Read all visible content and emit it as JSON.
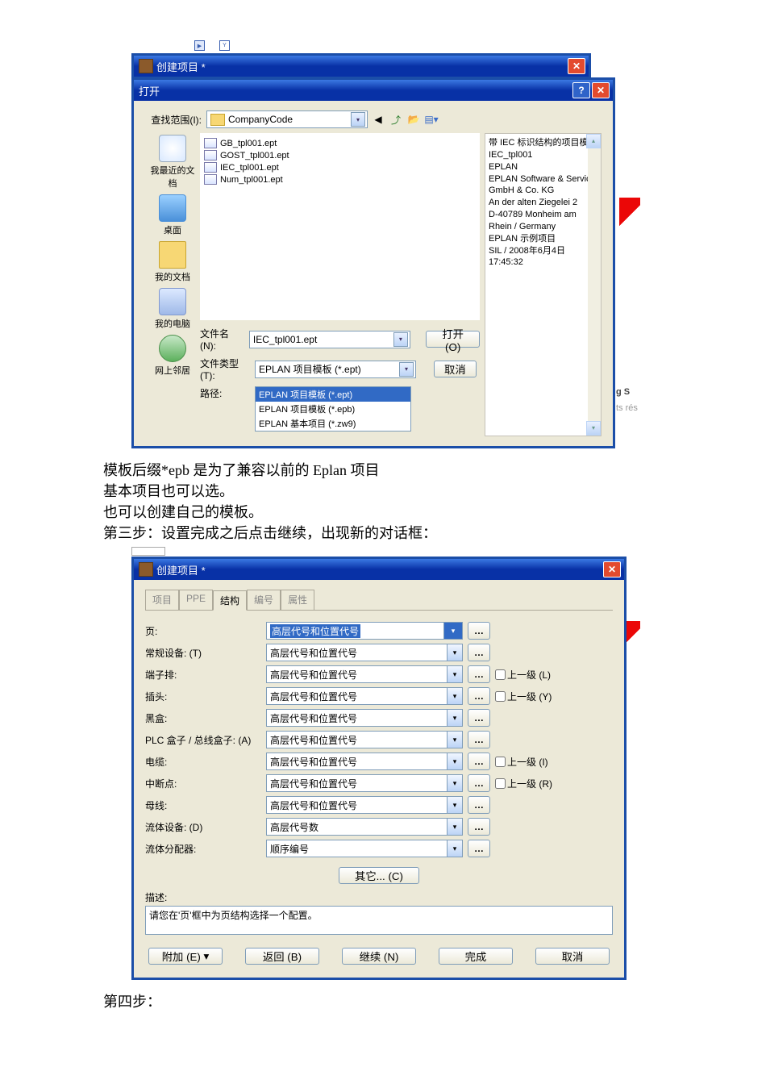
{
  "file_dialog": {
    "outer_title": "创建项目 *",
    "inner_title": "打开",
    "look_in_label": "查找范围(I):",
    "folder_name": "CompanyCode",
    "places": [
      {
        "label": "我最近的文档"
      },
      {
        "label": "桌面"
      },
      {
        "label": "我的文档"
      },
      {
        "label": "我的电脑"
      },
      {
        "label": "网上邻居"
      }
    ],
    "files": [
      {
        "name": "GB_tpl001.ept"
      },
      {
        "name": "GOST_tpl001.ept"
      },
      {
        "name": "IEC_tpl001.ept"
      },
      {
        "name": "Num_tpl001.ept"
      }
    ],
    "filename_label": "文件名(N):",
    "filename_value": "IEC_tpl001.ept",
    "filetype_label": "文件类型(T):",
    "filetype_value": "EPLAN 项目模板 (*.ept)",
    "filetype_options": [
      "EPLAN 项目模板 (*.ept)",
      "EPLAN 项目模板 (*.epb)",
      "EPLAN 基本项目 (*.zw9)"
    ],
    "path_label": "路径:",
    "open_btn": "打开(O)",
    "cancel_btn": "取消",
    "info_lines": [
      "带 IEC 标识结构的项目模板",
      "IEC_tpl001",
      "EPLAN",
      "EPLAN Software & Service",
      "GmbH & Co. KG",
      "An der alten Ziegelei 2",
      "D-40789 Monheim am Rhein / Germany",
      "EPLAN 示例项目",
      "SIL / 2008年6月4日 17:45:32"
    ]
  },
  "body_text": {
    "p1": "模板后缀*epb 是为了兼容以前的 Eplan 项目",
    "p2": "基本项目也可以选。",
    "p3": "也可以创建自己的模板。",
    "p4": "第三步：设置完成之后点击继续，出现新的对话框：",
    "p5": "第四步："
  },
  "wizard": {
    "title": "创建项目 *",
    "tabs": [
      "项目",
      "PPE",
      "结构",
      "编号",
      "属性"
    ],
    "active_tab": 2,
    "rows": [
      {
        "label": "页:",
        "value": "高层代号和位置代号",
        "selected": true,
        "up": false
      },
      {
        "label": "常规设备: (T)",
        "value": "高层代号和位置代号",
        "up": false
      },
      {
        "label": "端子排:",
        "value": "高层代号和位置代号",
        "up": true,
        "up_label": "上一级 (L)"
      },
      {
        "label": "插头:",
        "value": "高层代号和位置代号",
        "up": true,
        "up_label": "上一级 (Y)"
      },
      {
        "label": "黑盒:",
        "value": "高层代号和位置代号",
        "up": false
      },
      {
        "label": "PLC 盒子 / 总线盒子: (A)",
        "value": "高层代号和位置代号",
        "up": false
      },
      {
        "label": "电缆:",
        "value": "高层代号和位置代号",
        "up": true,
        "up_label": "上一级 (I)"
      },
      {
        "label": "中断点:",
        "value": "高层代号和位置代号",
        "up": true,
        "up_label": "上一级 (R)"
      },
      {
        "label": "母线:",
        "value": "高层代号和位置代号",
        "up": false
      },
      {
        "label": "流体设备: (D)",
        "value": "高层代号数",
        "up": false
      },
      {
        "label": "流体分配器:",
        "value": "顺序编号",
        "up": false
      }
    ],
    "other_btn": "其它... (C)",
    "desc_label": "描述:",
    "desc_text": "请您在'页'框中为页结构选择一个配置。",
    "buttons": {
      "extra": "附加 (E)",
      "back": "返回 (B)",
      "next": "继续 (N)",
      "finish": "完成",
      "cancel": "取消"
    }
  },
  "frag1": "g S",
  "frag2": "ts rés"
}
